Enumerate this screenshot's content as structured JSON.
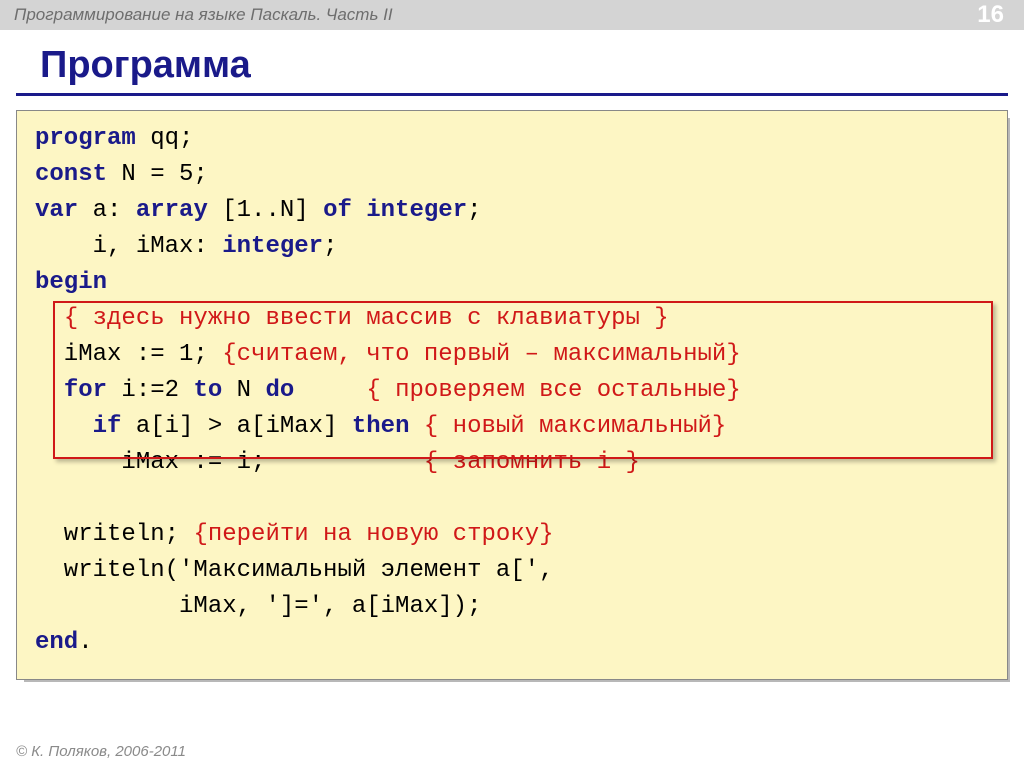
{
  "header": {
    "course_title": "Программирование на языке Паскаль. Часть II",
    "page_number": "16"
  },
  "title": "Программа",
  "code": {
    "l1_kw": "program",
    "l1_rest": " qq;",
    "l2_kw": "const",
    "l2_rest": " N = 5;",
    "l3_kw": "var",
    "l3_mid": " a: ",
    "l3_kw2": "array",
    "l3_mid2": " [1..N] ",
    "l3_kw3": "of",
    "l3_mid3": " ",
    "l3_kw4": "integer",
    "l3_end": ";",
    "l4_pre": "    i, iMax: ",
    "l4_kw": "integer",
    "l4_end": ";",
    "l5_kw": "begin",
    "l6_pre": "  ",
    "l6_cmt": "{ здесь нужно ввести массив с клавиатуры }",
    "l7_pre": "  iMax := 1; ",
    "l7_cmt": "{считаем, что первый – максимальный}",
    "l8_pre": "  ",
    "l8_kw": "for",
    "l8_mid": " i:=2 ",
    "l8_kw2": "to",
    "l8_mid2": " N ",
    "l8_kw3": "do",
    "l8_sp": "     ",
    "l8_cmt": "{ проверяем все остальные}",
    "l9_pre": "    ",
    "l9_kw": "if",
    "l9_mid": " a[i] > a[iMax] ",
    "l9_kw2": "then",
    "l9_sp": " ",
    "l9_cmt": "{ новый максимальный}",
    "l10_pre": "      iMax := i;           ",
    "l10_cmt": "{ запомнить i }",
    "l11_pre": "  writeln; ",
    "l11_cmt": "{перейти на новую строку}",
    "l12": "  writeln('Максимальный элемент a[',",
    "l13": "          iMax, ']=', a[iMax]);",
    "l14_kw": "end",
    "l14_end": "."
  },
  "footer": {
    "copyright": "© К. Поляков, 2006-2011"
  }
}
